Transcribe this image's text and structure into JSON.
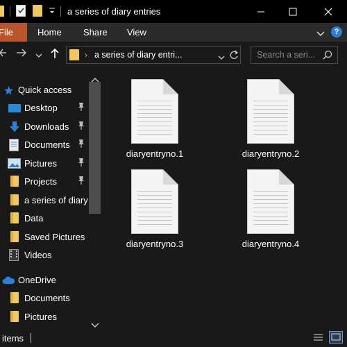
{
  "window": {
    "title": "a series of diary entries"
  },
  "ribbon": {
    "tabs": [
      "File",
      "Home",
      "Share",
      "View"
    ]
  },
  "address": {
    "path": "a series of diary entri..."
  },
  "search": {
    "placeholder": "Search a seri..."
  },
  "nav": {
    "quick_access": "Quick access",
    "items": [
      {
        "label": "Desktop",
        "icon": "desktop-icon",
        "pinned": true
      },
      {
        "label": "Downloads",
        "icon": "downloads-icon",
        "pinned": true
      },
      {
        "label": "Documents",
        "icon": "documents-icon",
        "pinned": true
      },
      {
        "label": "Pictures",
        "icon": "pictures-icon",
        "pinned": true
      },
      {
        "label": "Projects",
        "icon": "folder-icon",
        "pinned": true
      },
      {
        "label": "a series of diary",
        "icon": "folder-icon",
        "pinned": false
      },
      {
        "label": "Data",
        "icon": "folder-icon",
        "pinned": false
      },
      {
        "label": "Saved Pictures",
        "icon": "folder-icon",
        "pinned": false
      },
      {
        "label": "Videos",
        "icon": "videos-icon",
        "pinned": false
      }
    ],
    "onedrive": "OneDrive",
    "onedrive_items": [
      {
        "label": "Documents",
        "icon": "folder-icon"
      },
      {
        "label": "Pictures",
        "icon": "folder-icon"
      }
    ]
  },
  "files": [
    {
      "name": "diaryentryno.1"
    },
    {
      "name": "diaryentryno.2"
    },
    {
      "name": "diaryentryno.3"
    },
    {
      "name": "diaryentryno.4"
    }
  ],
  "status": {
    "items_text": "items"
  },
  "colors": {
    "background": "#191919",
    "titlebar": "#000000",
    "file_tab_accent": "#b9542b",
    "folder": "#f0c760",
    "quick_access_star": "#2f7fd6"
  }
}
